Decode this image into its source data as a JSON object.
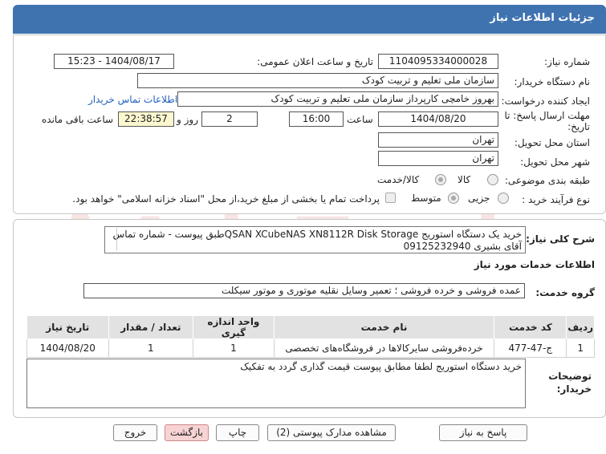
{
  "header": {
    "title": "جزئیات اطلاعات نیاز"
  },
  "form": {
    "need_number_label": "شماره نیاز:",
    "need_number": "1104095334000028",
    "announce_label": "تاریخ و ساعت اعلان عمومی:",
    "announce_value": "1404/08/17 - 15:23",
    "buyer_org_label": "نام دستگاه خریدار:",
    "buyer_org": "سازمان ملی تعلیم و تربیت کودک",
    "creator_label": "ایجاد کننده درخواست:",
    "creator": "بهروز خامچی کارپرداز سازمان ملی تعلیم و تربیت کودک",
    "contact_link": "اطلاعات تماس خریدار",
    "deadline_label_1": "مهلت ارسال پاسخ: تا",
    "deadline_label_2": "تاریخ:",
    "deadline_date": "1404/08/20",
    "time_label": "ساعت",
    "deadline_time": "16:00",
    "days_value": "2",
    "days_label": "روز و",
    "remaining_time": "22:38:57",
    "remaining_label": "ساعت باقی مانده",
    "province_label": "استان محل تحویل:",
    "province": "تهران",
    "city_label": "شهر محل تحویل:",
    "city": "تهران",
    "category_label": "طبقه بندی موضوعی:",
    "category_options": [
      "کالا",
      "کالا/خدمت"
    ],
    "process_label": "نوع فرآیند خرید :",
    "process_options": [
      "جزیی",
      "متوسط"
    ],
    "payment_note": "پرداخت تمام یا بخشی از مبلغ خرید،از محل \"اسناد خزانه اسلامی\" خواهد بود."
  },
  "details": {
    "general_desc_label": "شرح کلی نیاز:",
    "general_desc": "خرید یک دستگاه استوریج QSAN XCubeNAS XN8112R Disk Storageطبق پیوست - شماره تماس آقای بشیری 09125232940",
    "services_heading": "اطلاعات خدمات مورد نیاز",
    "service_group_label": "گروه خدمت:",
    "service_group": "عمده فروشی و خرده فروشی ؛ تعمیر وسایل نقلیه موتوری و موتور سیکلت",
    "table": {
      "headers": [
        "ردیف",
        "کد خدمت",
        "نام خدمت",
        "واحد اندازه گیری",
        "تعداد / مقدار",
        "تاریخ نیاز"
      ],
      "rows": [
        [
          "1",
          "ج-47-477",
          "خرده‌فروشی سایرکالاها در فروشگاه‌های تخصصی",
          "1",
          "1",
          "1404/08/20"
        ]
      ]
    },
    "buyer_notes_label_1": "توضیحات",
    "buyer_notes_label_2": "خریدار:",
    "buyer_notes": "خرید دستگاه استوریج لطفا مطابق پیوست قیمت گذاری گردد به تفکیک"
  },
  "buttons": {
    "reply": "پاسخ به نیاز",
    "view_docs": "مشاهده مدارک پیوستی (2)",
    "print": "چاپ",
    "back": "بازگشت",
    "exit": "خروج"
  }
}
